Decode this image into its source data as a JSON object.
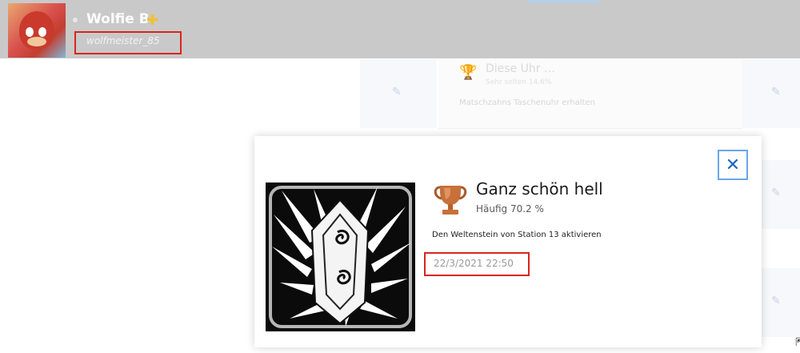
{
  "profile": {
    "display_name": "Wolfie B",
    "plus_icon": "plus-icon",
    "username": "wolfmeister_85"
  },
  "background_list": {
    "trophy_title": "Diese Uhr …",
    "trophy_rarity": "Sehr selten 14.6%",
    "trophy_desc": "Matschzahns Taschenuhr erhalten"
  },
  "trophy_modal": {
    "close_label": "✕",
    "name": "Ganz schön hell",
    "rarity": "Häufig 70.2 %",
    "description": "Den Weltenstein von Station 13 aktivieren",
    "earned_date": "22/3/2021 22:50",
    "trophy_tier": "bronze",
    "image_icon": "spiral-crystal-icon"
  },
  "colors": {
    "header_bg": "#c9c9c9",
    "highlight_border": "#d9251c",
    "close_border": "#6aa6e8",
    "close_x": "#1e62c2",
    "bronze": "#c8703a"
  }
}
